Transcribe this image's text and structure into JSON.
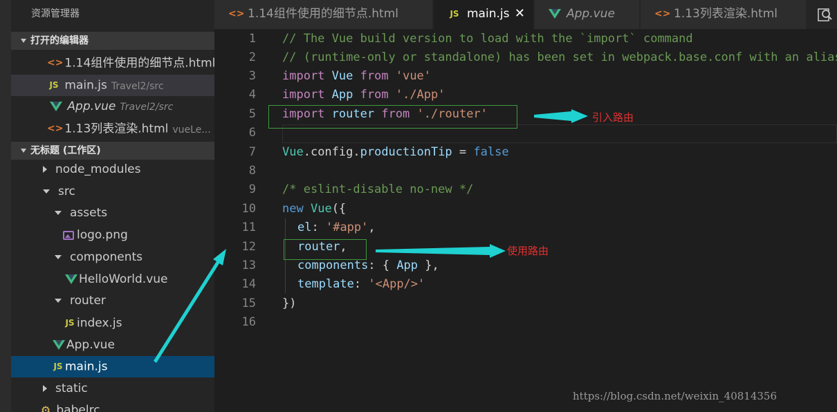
{
  "sidebar": {
    "title": "资源管理器",
    "open_editors": {
      "header": "打开的编辑器",
      "items": [
        {
          "name": "1.14组件使用的细节点.html",
          "desc": ""
        },
        {
          "name": "main.js",
          "desc": "Travel2/src"
        },
        {
          "name": "App.vue",
          "desc": "Travel2/src"
        },
        {
          "name": "1.13列表渲染.html",
          "desc": "vueLe..."
        }
      ]
    },
    "workspace": {
      "header": "无标题 (工作区)",
      "items": [
        {
          "label": "node_modules"
        },
        {
          "label": "src"
        },
        {
          "label": "assets"
        },
        {
          "label": "logo.png"
        },
        {
          "label": "components"
        },
        {
          "label": "HelloWorld.vue"
        },
        {
          "label": "router"
        },
        {
          "label": "index.js"
        },
        {
          "label": "App.vue"
        },
        {
          "label": "main.js"
        },
        {
          "label": "static"
        },
        {
          "label": ".babelrc"
        }
      ]
    }
  },
  "tabs": [
    {
      "label": "1.14组件使用的细节点.html",
      "icon": "html-icon"
    },
    {
      "label": "main.js",
      "icon": "js-icon",
      "active": true
    },
    {
      "label": "App.vue",
      "icon": "vue-icon"
    },
    {
      "label": "1.13列表渲染.html",
      "icon": "html-icon"
    }
  ],
  "tab_close_glyph": "✕",
  "editor": {
    "line_numbers": [
      "1",
      "2",
      "3",
      "4",
      "5",
      "6",
      "7",
      "8",
      "9",
      "10",
      "11",
      "12",
      "13",
      "14",
      "15",
      "16"
    ],
    "lines": {
      "l1": "// The Vue build version to load with the `import` command",
      "l2": "// (runtime-only or standalone) has been set in webpack.base.conf with an alias.",
      "l3": {
        "a": "import",
        "b": "Vue",
        "c": "from",
        "d": "'vue'"
      },
      "l4": {
        "a": "import",
        "b": "App",
        "c": "from",
        "d": "'./App'"
      },
      "l5": {
        "a": "import",
        "b": "router",
        "c": "from",
        "d": "'./router'"
      },
      "l7": {
        "a": "Vue",
        "b": ".config.",
        "c": "productionTip",
        "d": " = ",
        "e": "false"
      },
      "l9": "/* eslint-disable no-new */",
      "l10": {
        "a": "new",
        "b": "Vue",
        "c": "({"
      },
      "l11": {
        "a": "el",
        "b": ": ",
        "c": "'#app'",
        "d": ","
      },
      "l12": {
        "a": "router",
        "b": ","
      },
      "l13": {
        "a": "components",
        "b": ": { ",
        "c": "App",
        "d": " },"
      },
      "l14": {
        "a": "template",
        "b": ": ",
        "c": "'<App/>'"
      },
      "l15": "})"
    }
  },
  "annotations": {
    "import_router": "引入路由",
    "use_router": "使用路由"
  },
  "watermark": "https://blog.csdn.net/weixin_40814356",
  "colors": {
    "annotation_arrow": "#1fd1d1",
    "annotation_text": "#e03030",
    "highlight_box": "#3f9a3f",
    "selection": "#094771"
  }
}
